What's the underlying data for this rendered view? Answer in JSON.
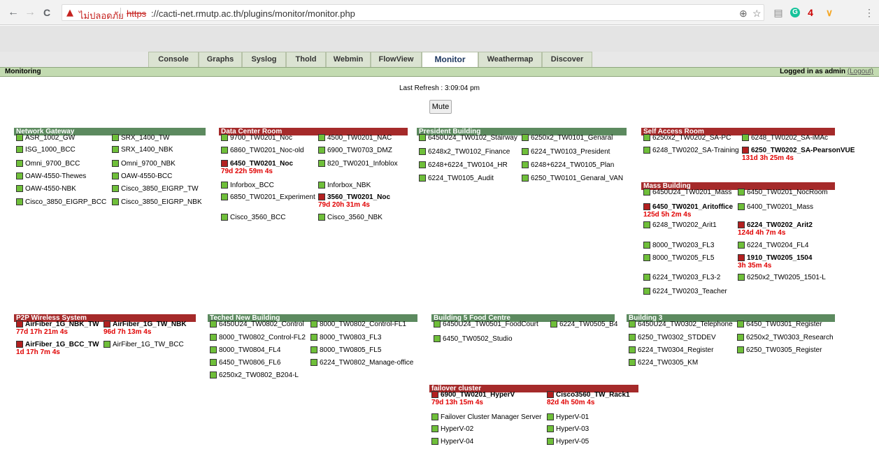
{
  "browser": {
    "back": "←",
    "forward": "→",
    "reload": "C",
    "insecure_label": "ไม่ปลอดภัย",
    "url_scheme": "https",
    "url_rest": "://cacti-net.rmutp.ac.th/plugins/monitor/monitor.php",
    "ext_badge": "4"
  },
  "tabs": [
    "Console",
    "Graphs",
    "Syslog",
    "Thold",
    "Webmin",
    "FlowView",
    "Monitor",
    "Weathermap",
    "Discover"
  ],
  "breadcrumb": "Monitoring",
  "login": {
    "prefix": "Logged in as ",
    "user": "admin",
    "logout": "(Logout)"
  },
  "last_refresh": "Last Refresh : 3:09:04 pm",
  "mute_label": "Mute",
  "colors": {
    "up": "#6fbf3a",
    "down": "#b22020",
    "header_ok": "#5c8a5f",
    "header_alert": "#a52a2a",
    "downtime": "#e00000"
  },
  "groups": [
    {
      "name": "Network Gateway",
      "status": "ok",
      "hosts": [
        {
          "name": "ASR_1002_GW",
          "status": "up"
        },
        {
          "name": "SRX_1400_TW",
          "status": "up"
        },
        {
          "name": "ISG_1000_BCC",
          "status": "up"
        },
        {
          "name": "SRX_1400_NBK",
          "status": "up"
        },
        {
          "name": "Omni_9700_BCC",
          "status": "up"
        },
        {
          "name": "Omni_9700_NBK",
          "status": "up"
        },
        {
          "name": "OAW-4550-Thewes",
          "status": "up"
        },
        {
          "name": "OAW-4550-BCC",
          "status": "up"
        },
        {
          "name": "OAW-4550-NBK",
          "status": "up"
        },
        {
          "name": "Cisco_3850_EIGRP_TW",
          "status": "up"
        },
        {
          "name": "Cisco_3850_EIGRP_BCC",
          "status": "up"
        },
        {
          "name": "Cisco_3850_EIGRP_NBK",
          "status": "up"
        }
      ]
    },
    {
      "name": "Data Center Room",
      "status": "alert",
      "hosts": [
        {
          "name": "9700_TW0201_Noc",
          "status": "up"
        },
        {
          "name": "4500_TW0201_NAC",
          "status": "up"
        },
        {
          "name": "6860_TW0201_Noc-old",
          "status": "up"
        },
        {
          "name": "6900_TW0703_DMZ",
          "status": "up"
        },
        {
          "name": "6450_TW0201_Noc",
          "status": "down",
          "downtime": "79d 22h 59m 4s"
        },
        {
          "name": "820_TW0201_Infoblox",
          "status": "up"
        },
        {
          "name": "Inforbox_BCC",
          "status": "up"
        },
        {
          "name": "Inforbox_NBK",
          "status": "up"
        },
        {
          "name": "6850_TW0201_Experiment",
          "status": "up"
        },
        {
          "name": "3560_TW0201_Noc",
          "status": "down",
          "downtime": "79d 20h 31m 4s"
        },
        {
          "name": "Cisco_3560_BCC",
          "status": "up"
        },
        {
          "name": "Cisco_3560_NBK",
          "status": "up"
        }
      ]
    },
    {
      "name": "President Building",
      "status": "ok",
      "hosts": [
        {
          "name": "6450U24_TW0102_Stairway",
          "status": "up"
        },
        {
          "name": "6250x2_TW0101_Genaral",
          "status": "up"
        },
        {
          "name": "6248x2_TW0102_Finance",
          "status": "up"
        },
        {
          "name": "6224_TW0103_President",
          "status": "up"
        },
        {
          "name": "6248+6224_TW0104_HR",
          "status": "up"
        },
        {
          "name": "6248+6224_TW0105_Plan",
          "status": "up"
        },
        {
          "name": "6224_TW0105_Audit",
          "status": "up"
        },
        {
          "name": "6250_TW0101_Genaral_VAN",
          "status": "up"
        }
      ]
    },
    {
      "name": "Self Access Room",
      "status": "alert",
      "hosts": [
        {
          "name": "6250x2_TW0202_SA-PC",
          "status": "up"
        },
        {
          "name": "6248_TW0202_SA-iMAc",
          "status": "up"
        },
        {
          "name": "6248_TW0202_SA-Training",
          "status": "up"
        },
        {
          "name": "6250_TW0202_SA-PearsonVUE",
          "status": "down",
          "downtime": "131d 3h 25m 4s"
        }
      ]
    },
    {
      "name": "Mass Building",
      "status": "alert",
      "hosts": [
        {
          "name": "6450U24_TW0201_Mass",
          "status": "up"
        },
        {
          "name": "6450_TW0201_NocRoom",
          "status": "up"
        },
        {
          "name": "6450_TW0201_Aritoffice",
          "status": "down",
          "downtime": "125d 5h 2m 4s"
        },
        {
          "name": "6400_TW0201_Mass",
          "status": "up"
        },
        {
          "name": "6248_TW0202_Arit1",
          "status": "up"
        },
        {
          "name": "6224_TW0202_Arit2",
          "status": "down",
          "downtime": "124d 4h 7m 4s"
        },
        {
          "name": "8000_TW0203_FL3",
          "status": "up"
        },
        {
          "name": "6224_TW0204_FL4",
          "status": "up"
        },
        {
          "name": "8000_TW0205_FL5",
          "status": "up"
        },
        {
          "name": "1910_TW0205_1504",
          "status": "down",
          "downtime": "3h 35m 4s"
        },
        {
          "name": "6224_TW0203_FL3-2",
          "status": "up"
        },
        {
          "name": "6250x2_TW0205_1501-L",
          "status": "up"
        },
        {
          "name": "6224_TW0203_Teacher",
          "status": "up"
        }
      ]
    },
    {
      "name": "P2P Wireless System",
      "status": "alert",
      "hosts": [
        {
          "name": "AirFiber_1G_NBK_TW",
          "status": "down",
          "downtime": "77d 17h 21m 4s"
        },
        {
          "name": "AirFiber_1G_TW_NBK",
          "status": "down",
          "downtime": "96d 7h 13m 4s"
        },
        {
          "name": "AirFiber_1G_BCC_TW",
          "status": "down",
          "downtime": "1d 17h 7m 4s"
        },
        {
          "name": "AirFiber_1G_TW_BCC",
          "status": "up"
        }
      ]
    },
    {
      "name": "Teched New Building",
      "status": "ok",
      "hosts": [
        {
          "name": "6450U24_TW0802_Control",
          "status": "up"
        },
        {
          "name": "8000_TW0802_Control-FL1",
          "status": "up"
        },
        {
          "name": "8000_TW0802_Control-FL2",
          "status": "up"
        },
        {
          "name": "8000_TW0803_FL3",
          "status": "up"
        },
        {
          "name": "8000_TW0804_FL4",
          "status": "up"
        },
        {
          "name": "8000_TW0805_FL5",
          "status": "up"
        },
        {
          "name": "6450_TW0806_FL6",
          "status": "up"
        },
        {
          "name": "6224_TW0802_Manage-office",
          "status": "up"
        },
        {
          "name": "6250x2_TW0802_B204-L",
          "status": "up"
        }
      ]
    },
    {
      "name": "Building 5 Food Centre",
      "status": "ok",
      "hosts": [
        {
          "name": "6450U24_TW0501_FoodCourt",
          "status": "up"
        },
        {
          "name": "6224_TW0505_B4",
          "status": "up"
        },
        {
          "name": "6450_TW0502_Studio",
          "status": "up"
        }
      ]
    },
    {
      "name": "Building 3",
      "status": "ok",
      "hosts": [
        {
          "name": "6450U24_TW0302_Telephone",
          "status": "up"
        },
        {
          "name": "6450_TW0301_Register",
          "status": "up"
        },
        {
          "name": "6250_TW0302_STDDEV",
          "status": "up"
        },
        {
          "name": "6250x2_TW0303_Research",
          "status": "up"
        },
        {
          "name": "6224_TW0304_Register",
          "status": "up"
        },
        {
          "name": "6250_TW0305_Register",
          "status": "up"
        },
        {
          "name": "6224_TW0305_KM",
          "status": "up"
        }
      ]
    },
    {
      "name": "failover cluster",
      "status": "alert",
      "hosts": [
        {
          "name": "6900_TW0201_HyperV",
          "status": "down",
          "downtime": "79d 13h 15m 4s"
        },
        {
          "name": "Cisco3560_TW_Rack1",
          "status": "down",
          "downtime": "82d 4h 50m 4s"
        },
        {
          "name": "Failover Cluster Manager Server",
          "status": "up"
        },
        {
          "name": "HyperV-01",
          "status": "up"
        },
        {
          "name": "HyperV-02",
          "status": "up"
        },
        {
          "name": "HyperV-03",
          "status": "up"
        },
        {
          "name": "HyperV-04",
          "status": "up"
        },
        {
          "name": "HyperV-05",
          "status": "up"
        }
      ]
    }
  ]
}
